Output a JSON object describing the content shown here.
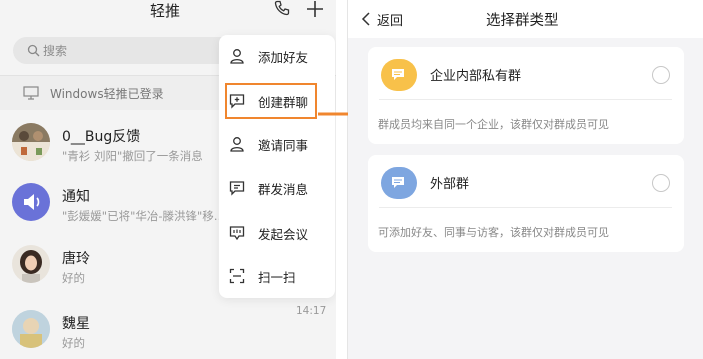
{
  "left": {
    "title": "轻推",
    "search_placeholder": "搜索",
    "login_status": "Windows轻推已登录",
    "chats": [
      {
        "name": "0__Bug反馈",
        "message": "\"青衫 刘阳\"撤回了一条消息",
        "time": ""
      },
      {
        "name": "通知",
        "message": "\"彭媛媛\"已将\"华冶-滕洪锋\"移…",
        "time": ""
      },
      {
        "name": "唐玲",
        "message": "好的",
        "time": ""
      },
      {
        "name": "魏星",
        "message": "好的",
        "time": "14:17"
      }
    ]
  },
  "menu": {
    "items": [
      {
        "label": "添加好友",
        "icon": "person-icon"
      },
      {
        "label": "创建群聊",
        "icon": "chat-plus-icon"
      },
      {
        "label": "邀请同事",
        "icon": "person-invite-icon"
      },
      {
        "label": "群发消息",
        "icon": "broadcast-icon"
      },
      {
        "label": "发起会议",
        "icon": "meeting-icon"
      },
      {
        "label": "扫一扫",
        "icon": "scan-icon"
      }
    ],
    "highlight_color": "#f0862e"
  },
  "right": {
    "back_label": "返回",
    "title": "选择群类型",
    "options": [
      {
        "title": "企业内部私有群",
        "description": "群成员均来自同一个企业，该群仅对群成员可见",
        "icon_color": "#f8c14a",
        "icon": "group-chat-icon"
      },
      {
        "title": "外部群",
        "description": "可添加好友、同事与访客，该群仅对群成员可见",
        "icon_color": "#7ea6e0",
        "icon": "group-chat-icon"
      }
    ]
  },
  "colors": {
    "accent_orange": "#f0862e",
    "notice_purple": "#6a72d8"
  }
}
